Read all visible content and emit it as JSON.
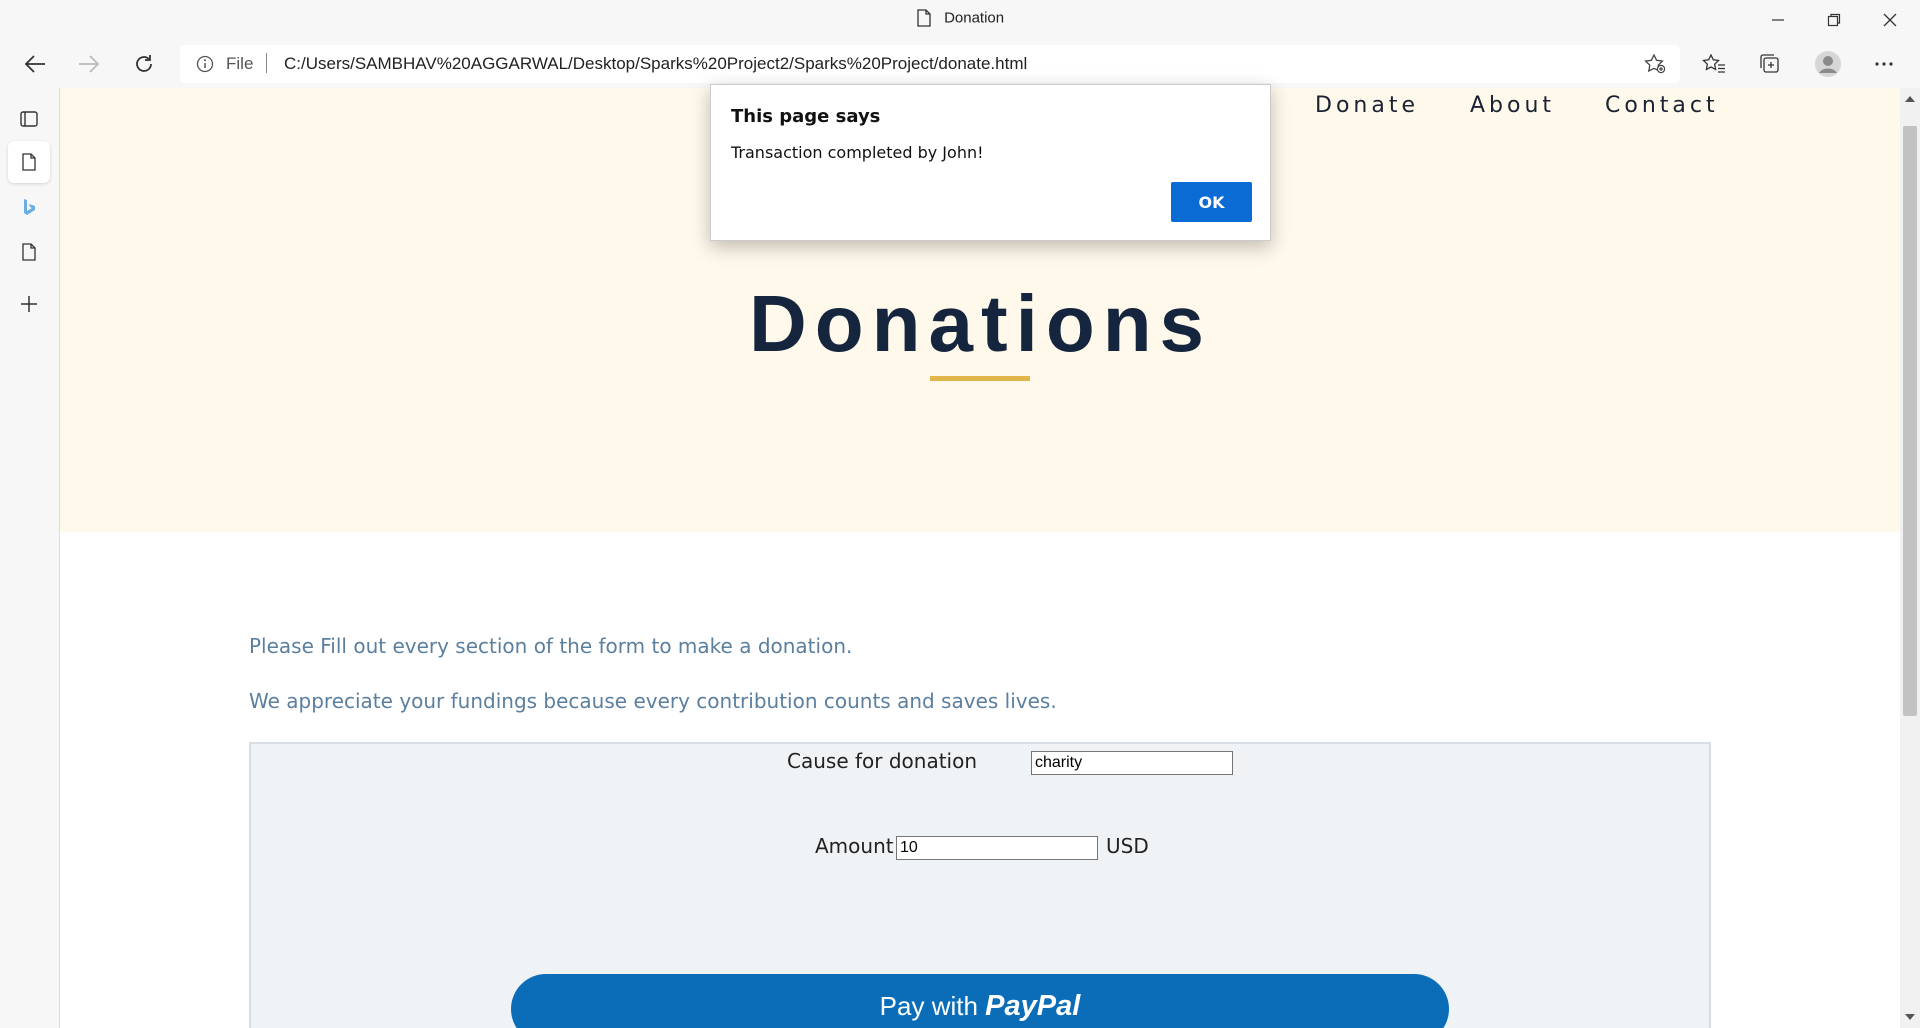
{
  "window": {
    "title": "Donation"
  },
  "toolbar": {
    "file_label": "File",
    "url": "C:/Users/SAMBHAV%20AGGARWAL/Desktop/Sparks%20Project2/Sparks%20Project/donate.html"
  },
  "page": {
    "nav": [
      "Donate",
      "About",
      "Contact"
    ],
    "heading": "Donations",
    "para1": "Please Fill out every section of the form to make a donation.",
    "para2": "We appreciate your fundings because every contribution counts and saves lives.",
    "form": {
      "cause_label": "Cause for donation",
      "cause_value": "charity",
      "amount_label": "Amount",
      "amount_value": "10",
      "currency": "USD",
      "paypal_prefix": "Pay with",
      "paypal_brand": "PayPal"
    },
    "colors": {
      "hero_bg": "#fff9ec",
      "heading": "#14253d",
      "accent_underline": "#e0b64a",
      "paypal_blue": "#0b6db8"
    }
  },
  "dialog": {
    "title": "This page says",
    "message": "Transaction completed by John!",
    "ok_label": "OK"
  }
}
